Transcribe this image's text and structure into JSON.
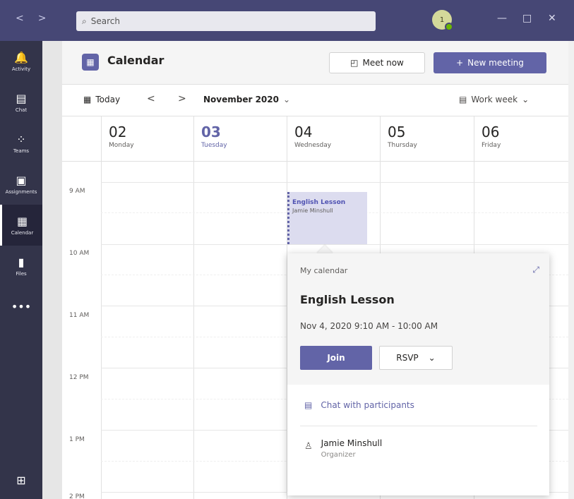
{
  "titlebar": {
    "nav_back": "<",
    "nav_forward": ">",
    "search_placeholder": "Search",
    "avatar_initial": "1",
    "minimize": "—",
    "maximize": "□",
    "close": "✕"
  },
  "rail": {
    "items": [
      {
        "label": "Activity",
        "icon": "bell-icon",
        "glyph": "🔔"
      },
      {
        "label": "Chat",
        "icon": "chat-icon",
        "glyph": "▤"
      },
      {
        "label": "Teams",
        "icon": "teams-icon",
        "glyph": "⁘"
      },
      {
        "label": "Assignments",
        "icon": "assignments-icon",
        "glyph": "▣"
      },
      {
        "label": "Calendar",
        "icon": "calendar-icon",
        "glyph": "▦"
      },
      {
        "label": "Files",
        "icon": "files-icon",
        "glyph": "▮"
      },
      {
        "label": "",
        "icon": "more-icon",
        "glyph": "•••"
      }
    ],
    "apps_glyph": "⊞"
  },
  "header": {
    "title": "Calendar",
    "meet_now": "Meet now",
    "new_meeting": "New meeting"
  },
  "toolbar": {
    "today": "Today",
    "prev": "<",
    "next": ">",
    "month": "November 2020",
    "view": "Work week"
  },
  "days": [
    {
      "num": "02",
      "name": "Monday"
    },
    {
      "num": "03",
      "name": "Tuesday"
    },
    {
      "num": "04",
      "name": "Wednesday"
    },
    {
      "num": "05",
      "name": "Thursday"
    },
    {
      "num": "06",
      "name": "Friday"
    }
  ],
  "times": [
    "9 AM",
    "10 AM",
    "11 AM",
    "12 PM",
    "1 PM",
    "2 PM"
  ],
  "event": {
    "title": "English Lesson",
    "organizer": "Jamie Minshull"
  },
  "popup": {
    "calendar": "My calendar",
    "title": "English Lesson",
    "time": "Nov 4, 2020 9:10 AM - 10:00 AM",
    "join": "Join",
    "rsvp": "RSVP",
    "chat": "Chat with participants",
    "person_name": "Jamie Minshull",
    "person_role": "Organizer"
  },
  "colors": {
    "titlebar": "#464775",
    "rail": "#33344a",
    "accent": "#6264a7"
  }
}
